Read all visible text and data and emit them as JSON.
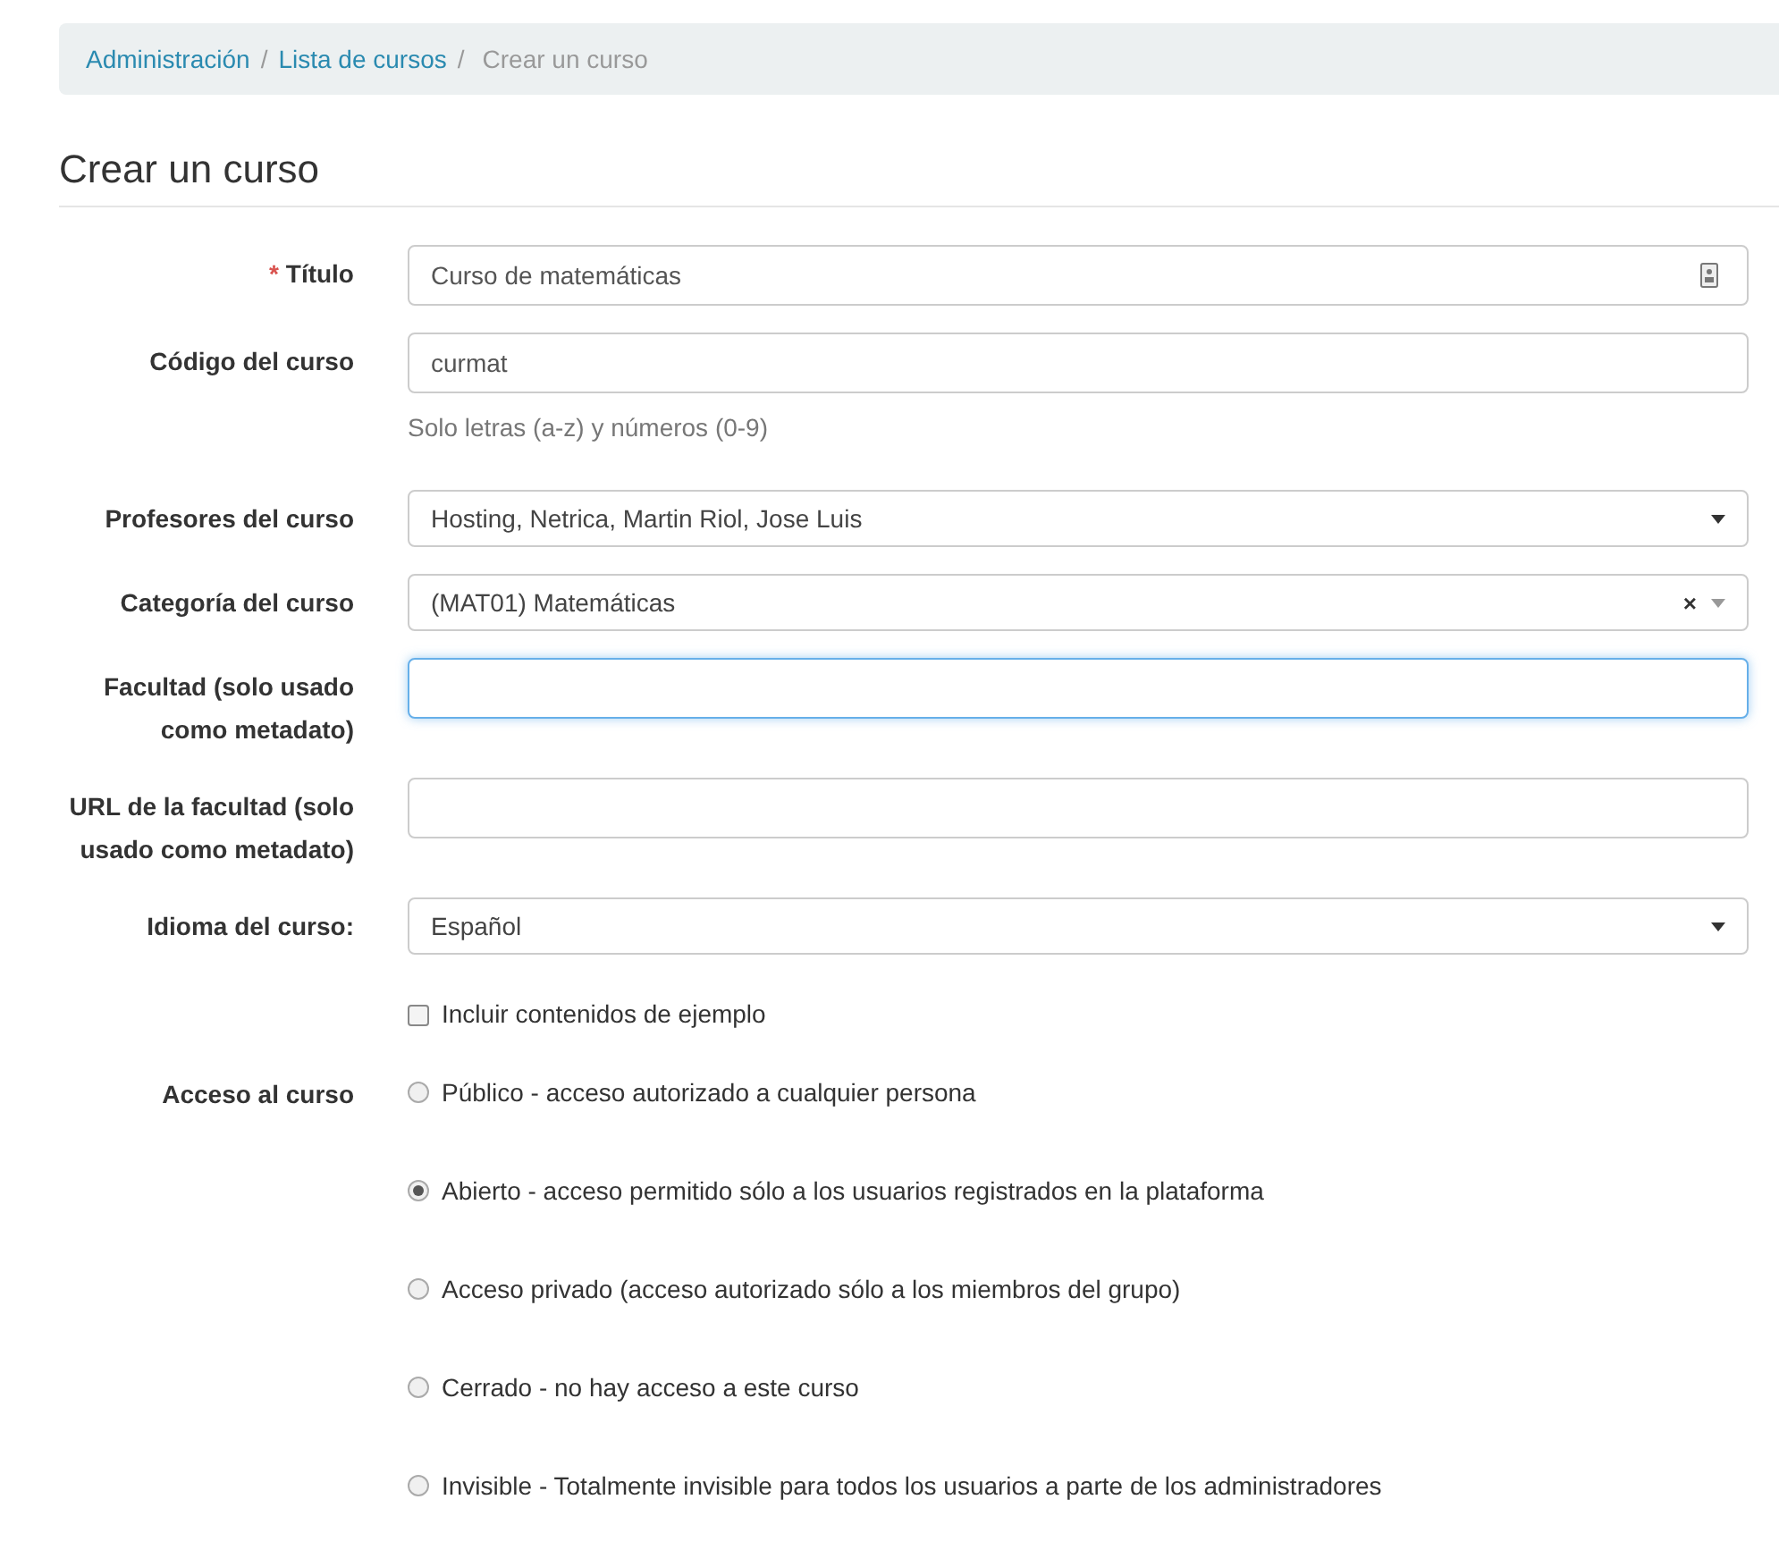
{
  "breadcrumb": [
    {
      "label": "Administración",
      "kind": "link"
    },
    {
      "separator": "/",
      "label": "Lista de cursos",
      "kind": "link"
    },
    {
      "separator": "/",
      "label": "Crear un curso",
      "kind": "current"
    }
  ],
  "page_title": "Crear un curso",
  "fields": [
    {
      "label": "Título",
      "required_mark": "*",
      "kind": "text",
      "value": "Curso de matemáticas",
      "focused": false,
      "has_icon": true
    },
    {
      "label": "Código del curso",
      "kind": "text",
      "value": "curmat",
      "focused": false,
      "help": "Solo letras (a-z) y números (0-9)"
    },
    {
      "label": "Profesores del curso",
      "kind": "select",
      "value": "Hosting, Netrica, Martin Riol, Jose Luis"
    },
    {
      "label": "Categoría del curso",
      "kind": "select",
      "value": "(MAT01) Matemáticas",
      "clear_symbol": "×"
    },
    {
      "label": "Facultad (solo usado como metadato)",
      "kind": "text",
      "focused": true
    },
    {
      "label": "URL de la facultad (solo usado como metadato)",
      "kind": "text",
      "focused": false
    },
    {
      "label": "Idioma del curso:",
      "kind": "select",
      "value": "Español"
    }
  ],
  "sample_content": {
    "label": "Incluir contenidos de ejemplo",
    "checked": false
  },
  "access": {
    "label": "Acceso al curso",
    "options": [
      {
        "label": "Público - acceso autorizado a cualquier persona",
        "selected": false
      },
      {
        "label": "Abierto - acceso permitido sólo a los usuarios registrados en la plataforma",
        "selected": true
      },
      {
        "label": "Acceso privado (acceso autorizado sólo a los miembros del grupo)",
        "selected": false
      },
      {
        "label": "Cerrado - no hay acceso a este curso",
        "selected": false
      },
      {
        "label": "Invisible - Totalmente invisible para todos los usuarios a parte de los administradores",
        "selected": false
      }
    ]
  }
}
